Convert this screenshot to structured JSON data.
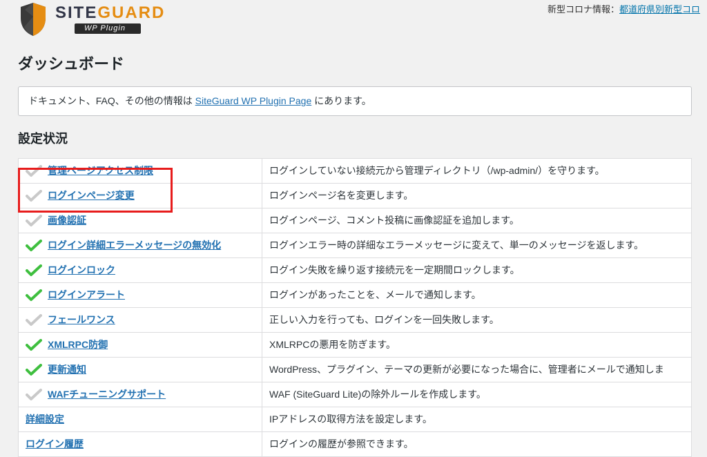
{
  "topbar": {
    "label_prefix": "新型コロナ情報：",
    "link_text": "都道府県別新型コロ"
  },
  "logo": {
    "main_a": "SITE",
    "main_b": "GUARD",
    "sub": "WP Plugin"
  },
  "page_title": "ダッシュボード",
  "notice": {
    "prefix": "ドキュメント、FAQ、その他の情報は ",
    "link_text": "SiteGuard WP Plugin Page",
    "suffix": " にあります。"
  },
  "section_title": "設定状況",
  "rows": [
    {
      "enabled": false,
      "label": "管理ページアクセス制限",
      "desc": "ログインしていない接続元から管理ディレクトリ（/wp-admin/）を守ります。"
    },
    {
      "enabled": false,
      "label": "ログインページ変更",
      "desc": "ログインページ名を変更します。"
    },
    {
      "enabled": false,
      "label": "画像認証",
      "desc": "ログインページ、コメント投稿に画像認証を追加します。"
    },
    {
      "enabled": true,
      "label": "ログイン詳細エラーメッセージの無効化",
      "desc": "ログインエラー時の詳細なエラーメッセージに変えて、単一のメッセージを返します。"
    },
    {
      "enabled": true,
      "label": "ログインロック",
      "desc": "ログイン失敗を繰り返す接続元を一定期間ロックします。"
    },
    {
      "enabled": true,
      "label": "ログインアラート",
      "desc": "ログインがあったことを、メールで通知します。"
    },
    {
      "enabled": false,
      "label": "フェールワンス",
      "desc": "正しい入力を行っても、ログインを一回失敗します。"
    },
    {
      "enabled": true,
      "label": "XMLRPC防御",
      "desc": "XMLRPCの悪用を防ぎます。"
    },
    {
      "enabled": true,
      "label": "更新通知",
      "desc": "WordPress、プラグイン、テーマの更新が必要になった場合に、管理者にメールで通知しま"
    },
    {
      "enabled": false,
      "label": "WAFチューニングサポート",
      "desc": "WAF (SiteGuard Lite)の除外ルールを作成します。"
    },
    {
      "enabled": null,
      "label": "詳細設定",
      "desc": "IPアドレスの取得方法を設定します。"
    },
    {
      "enabled": null,
      "label": "ログイン履歴",
      "desc": "ログインの履歴が参照できます。"
    }
  ]
}
